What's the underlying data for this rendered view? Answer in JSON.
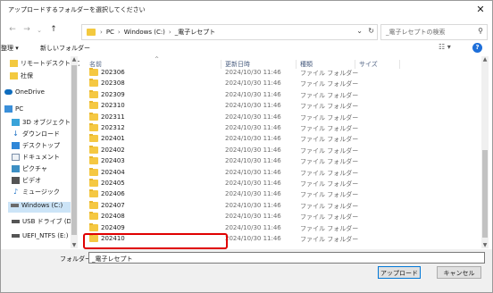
{
  "window": {
    "title": "アップロードするフォルダーを選択してください",
    "close_glyph": "✕"
  },
  "nav": {
    "back_glyph": "←",
    "forward_glyph": "→",
    "recent_glyph": "⌄",
    "up_glyph": "↑",
    "breadcrumb": [
      "PC",
      "Windows (C:)",
      "_電子レセプト"
    ],
    "search_placeholder": "_電子レセプトの検索"
  },
  "toolbar": {
    "organize_label": "整理 ▾",
    "new_folder_label": "新しいフォルダー",
    "view_glyph": "☷ ▾",
    "help_glyph": "?"
  },
  "sidebar": {
    "items": [
      {
        "label": "リモートデスクトップ ^",
        "icon": "folder-icon",
        "color": "#f3c93f"
      },
      {
        "label": "社保",
        "icon": "folder-icon",
        "color": "#f3c93f"
      },
      {
        "label": "OneDrive",
        "icon": "cloud-icon",
        "color": "#0f6cbd"
      },
      {
        "label": "PC",
        "icon": "pc-icon",
        "color": "#3a8fd9"
      },
      {
        "label": "3D オブジェクト",
        "icon": "3d-objects-icon",
        "color": "#3aa3d9"
      },
      {
        "label": "ダウンロード",
        "icon": "download-icon",
        "color": "#2173c6"
      },
      {
        "label": "デスクトップ",
        "icon": "desktop-icon",
        "color": "#2f87d8"
      },
      {
        "label": "ドキュメント",
        "icon": "documents-icon",
        "color": "#7a8ea8"
      },
      {
        "label": "ピクチャ",
        "icon": "pictures-icon",
        "color": "#3d8fc4"
      },
      {
        "label": "ビデオ",
        "icon": "videos-icon",
        "color": "#545454"
      },
      {
        "label": "ミュージック",
        "icon": "music-icon",
        "color": "#2173c6"
      },
      {
        "label": "Windows (C:)",
        "icon": "drive-icon",
        "color": "#6b6b6b"
      },
      {
        "label": "USB ドライブ (D:)",
        "icon": "usb-drive-icon",
        "color": "#555555"
      },
      {
        "label": "UEFI_NTFS (E:)",
        "icon": "usb-drive-icon",
        "color": "#555555"
      }
    ],
    "selected_index": 11
  },
  "columns": {
    "name": "名前",
    "date": "更新日時",
    "type": "種類",
    "size": "サイズ"
  },
  "files": [
    {
      "name": "202306",
      "date": "2024/10/30 11:46",
      "type": "ファイル フォルダー"
    },
    {
      "name": "202308",
      "date": "2024/10/30 11:46",
      "type": "ファイル フォルダー"
    },
    {
      "name": "202309",
      "date": "2024/10/30 11:46",
      "type": "ファイル フォルダー"
    },
    {
      "name": "202310",
      "date": "2024/10/30 11:46",
      "type": "ファイル フォルダー"
    },
    {
      "name": "202311",
      "date": "2024/10/30 11:46",
      "type": "ファイル フォルダー"
    },
    {
      "name": "202312",
      "date": "2024/10/30 11:46",
      "type": "ファイル フォルダー"
    },
    {
      "name": "202401",
      "date": "2024/10/30 11:46",
      "type": "ファイル フォルダー"
    },
    {
      "name": "202402",
      "date": "2024/10/30 11:46",
      "type": "ファイル フォルダー"
    },
    {
      "name": "202403",
      "date": "2024/10/30 11:46",
      "type": "ファイル フォルダー"
    },
    {
      "name": "202404",
      "date": "2024/10/30 11:46",
      "type": "ファイル フォルダー"
    },
    {
      "name": "202405",
      "date": "2024/10/30 11:46",
      "type": "ファイル フォルダー"
    },
    {
      "name": "202406",
      "date": "2024/10/30 11:46",
      "type": "ファイル フォルダー"
    },
    {
      "name": "202407",
      "date": "2024/10/30 11:46",
      "type": "ファイル フォルダー"
    },
    {
      "name": "202408",
      "date": "2024/10/30 11:46",
      "type": "ファイル フォルダー"
    },
    {
      "name": "202409",
      "date": "2024/10/30 11:46",
      "type": "ファイル フォルダー"
    },
    {
      "name": "202410",
      "date": "2024/10/30 11:46",
      "type": "ファイル フォルダー"
    }
  ],
  "footer": {
    "folder_label": "フォルダー:",
    "folder_value": "_電子レセプト",
    "upload_label": "アップロード",
    "cancel_label": "キャンセル"
  },
  "colors": {
    "highlight": "#e00000",
    "folder": "#f5c842",
    "accent": "#0078d7"
  }
}
